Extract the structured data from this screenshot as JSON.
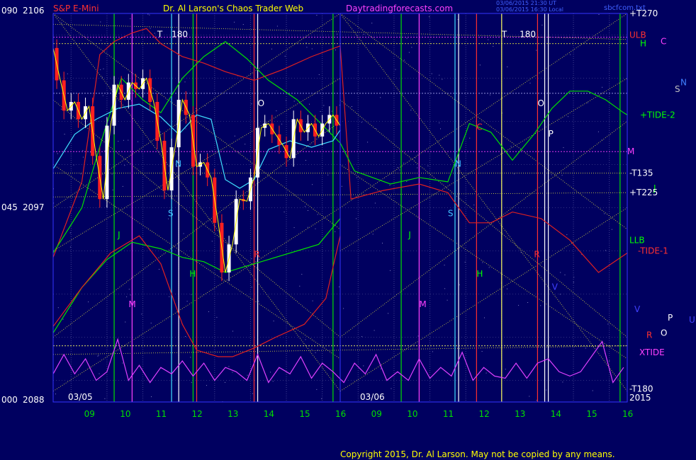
{
  "header": {
    "instrument": "S&P E-Mini",
    "site": "Dr. Al Larson's Chaos Trader Web",
    "url": "Daytradingforecasts.com",
    "stamp1": "03/06/2015 21:30 UT",
    "stamp2": "03/06/2015 16:30 Local",
    "file": "sbcfcom.txt"
  },
  "copyright": "Copyright 2015, Dr. Al Larson. May not be copied by any means.",
  "colors": {
    "background": "#000060",
    "frame": "#3333ff",
    "price": "#ffffff",
    "down_candle": "#ff2020",
    "yellow": "#ffff00",
    "green": "#00e000",
    "magenta": "#ff40ff",
    "cyan": "#40e0ff",
    "red": "#e02020",
    "xtide": "#e040ff"
  },
  "chart_data": {
    "type": "line",
    "title": "S&P E-Mini",
    "y_axis_labels": [
      {
        "index": "090",
        "price": "2106"
      },
      {
        "index": "045",
        "price": "2097"
      },
      {
        "index": "000",
        "price": "2088"
      }
    ],
    "ylim": [
      2088,
      2106
    ],
    "sessions": [
      {
        "date": "03/05",
        "hours": [
          "09",
          "10",
          "11",
          "12",
          "13",
          "14",
          "15",
          "16"
        ]
      },
      {
        "date": "03/06",
        "hours": [
          "09",
          "10",
          "11",
          "12",
          "13",
          "14",
          "15",
          "16"
        ]
      }
    ],
    "right_labels": [
      {
        "text": "+T270",
        "color": "#ffffff",
        "price": 2106
      },
      {
        "text": "ULB",
        "color": "#ff3030",
        "price": 2105
      },
      {
        "text": "H",
        "color": "#00ff00",
        "price": 2104.6
      },
      {
        "text": "C",
        "color": "#ff40ff",
        "price": 2104.7
      },
      {
        "text": "N",
        "color": "#4080ff",
        "price": 2102.8
      },
      {
        "text": "S",
        "color": "#c0c0c0",
        "price": 2102.5
      },
      {
        "text": "+TIDE-2",
        "color": "#00ff00",
        "price": 2101.3
      },
      {
        "text": "M",
        "color": "#ff40ff",
        "price": 2099.6
      },
      {
        "text": "-T135",
        "color": "#ffffff",
        "price": 2098.6
      },
      {
        "text": "J",
        "color": "#00ff00",
        "price": 2097.9
      },
      {
        "text": "+T225",
        "color": "#ffffff",
        "price": 2097.7
      },
      {
        "text": "LLB",
        "color": "#00ff00",
        "price": 2095.5
      },
      {
        "text": "-TIDE-1",
        "color": "#ff3030",
        "price": 2095.0
      },
      {
        "text": "V",
        "color": "#4040ff",
        "price": 2092.3
      },
      {
        "text": "P",
        "color": "#ffffff",
        "price": 2091.9
      },
      {
        "text": "U",
        "color": "#4040ff",
        "price": 2091.8
      },
      {
        "text": "R",
        "color": "#ff3030",
        "price": 2091.1
      },
      {
        "text": "O",
        "color": "#ffffff",
        "price": 2091.2
      },
      {
        "text": "XTIDE",
        "color": "#ff40ff",
        "price": 2090.3
      },
      {
        "text": "-T180",
        "color": "#ffffff",
        "price": 2088.6
      },
      {
        "text": "2015",
        "color": "#ffffff",
        "price": 2088.2
      }
    ],
    "inline_labels": [
      {
        "text": "T",
        "color": "#ffffff",
        "x": 10.9,
        "price": 2104.9
      },
      {
        "text": "180",
        "color": "#ffffff",
        "x": 11.3,
        "price": 2104.9
      },
      {
        "text": "T",
        "color": "#ffffff",
        "x": 20.5,
        "price": 2104.9
      },
      {
        "text": "180",
        "color": "#ffffff",
        "x": 21.0,
        "price": 2104.9
      },
      {
        "text": "O",
        "color": "#ffffff",
        "x": 13.7,
        "price": 2101.7
      },
      {
        "text": "O",
        "color": "#ffffff",
        "x": 21.5,
        "price": 2101.7
      },
      {
        "text": "C",
        "color": "#ff3030",
        "x": 19.8,
        "price": 2100.6
      },
      {
        "text": "P",
        "color": "#ffffff",
        "x": 21.8,
        "price": 2100.3
      },
      {
        "text": "N",
        "color": "#40c0ff",
        "x": 11.4,
        "price": 2098.9
      },
      {
        "text": "N",
        "color": "#40c0ff",
        "x": 19.2,
        "price": 2098.9
      },
      {
        "text": "S",
        "color": "#40c0ff",
        "x": 11.2,
        "price": 2096.6
      },
      {
        "text": "S",
        "color": "#40c0ff",
        "x": 19.0,
        "price": 2096.6
      },
      {
        "text": "J",
        "color": "#00ff00",
        "x": 9.8,
        "price": 2095.6
      },
      {
        "text": "J",
        "color": "#00ff00",
        "x": 17.9,
        "price": 2095.6
      },
      {
        "text": "R",
        "color": "#ff3030",
        "x": 13.6,
        "price": 2094.7
      },
      {
        "text": "R",
        "color": "#ff3030",
        "x": 21.4,
        "price": 2094.7
      },
      {
        "text": "H",
        "color": "#00ff00",
        "x": 11.8,
        "price": 2093.8
      },
      {
        "text": "H",
        "color": "#00ff00",
        "x": 19.8,
        "price": 2093.8
      },
      {
        "text": "V",
        "color": "#4040ff",
        "x": 21.9,
        "price": 2093.2
      },
      {
        "text": "M",
        "color": "#ff40ff",
        "x": 10.1,
        "price": 2092.4
      },
      {
        "text": "M",
        "color": "#ff40ff",
        "x": 18.2,
        "price": 2092.4
      }
    ],
    "series": [
      {
        "name": "price",
        "color": "#ffffff",
        "x": [
          8.0,
          8.2,
          8.4,
          8.6,
          8.8,
          9.0,
          9.2,
          9.4,
          9.6,
          9.8,
          10.0,
          10.2,
          10.4,
          10.6,
          10.8,
          11.0,
          11.2,
          11.4,
          11.6,
          11.8,
          12.0,
          12.2,
          12.4,
          12.6,
          12.8,
          13.0,
          13.2,
          13.4,
          13.6,
          13.8,
          14.0,
          14.2,
          14.4,
          14.6,
          14.8,
          15.0,
          15.2,
          15.4,
          15.6,
          15.8,
          16.0
        ],
        "y": [
          2104.4,
          2102.9,
          2101.5,
          2101.9,
          2101.1,
          2101.7,
          2099.4,
          2097.4,
          2100.8,
          2102.7,
          2102.0,
          2102.8,
          2102.5,
          2103.0,
          2101.9,
          2100.1,
          2097.8,
          2099.8,
          2102.0,
          2101.3,
          2098.9,
          2099.1,
          2098.4,
          2096.3,
          2094.0,
          2095.3,
          2097.4,
          2097.3,
          2098.4,
          2100.7,
          2100.9,
          2100.4,
          2099.9,
          2099.3,
          2101.1,
          2100.5,
          2100.9,
          2100.3,
          2100.9,
          2101.3,
          2100.8
        ]
      },
      {
        "name": "ULB",
        "color": "#e02020",
        "x": [
          8.0,
          8.8,
          9.3,
          9.7,
          10.2,
          10.6,
          11.0,
          11.6,
          12.2,
          12.8,
          13.6,
          14.4,
          15.2,
          16.0,
          16.3,
          17.2,
          18.2,
          19.0,
          19.6,
          20.2,
          20.8,
          21.6,
          22.4,
          23.2,
          24.0
        ],
        "y": [
          2094.7,
          2098.2,
          2104.1,
          2104.7,
          2105.1,
          2105.3,
          2104.6,
          2104.0,
          2103.7,
          2103.3,
          2102.9,
          2103.4,
          2104.0,
          2104.5,
          2097.4,
          2097.8,
          2098.1,
          2097.7,
          2096.3,
          2096.3,
          2096.8,
          2096.5,
          2095.5,
          2094.0,
          2094.9
        ]
      },
      {
        "name": "LLB",
        "color": "#00e000",
        "x": [
          8.0,
          8.8,
          9.4,
          9.9,
          10.5,
          11.0,
          11.6,
          12.2,
          12.8,
          13.4,
          14.0,
          14.8,
          15.4,
          16.0,
          16.4,
          17.4,
          18.2,
          19.0,
          19.6,
          20.2,
          20.8,
          21.4,
          21.9,
          22.4,
          22.9,
          23.4,
          23.9,
          24.0
        ],
        "y": [
          2094.9,
          2097.0,
          2100.4,
          2103.0,
          2102.0,
          2101.4,
          2103.0,
          2104.0,
          2104.7,
          2103.9,
          2102.9,
          2102.0,
          2101.0,
          2100.0,
          2098.7,
          2098.1,
          2098.4,
          2098.2,
          2100.9,
          2100.5,
          2099.2,
          2100.4,
          2101.6,
          2102.4,
          2102.4,
          2102.0,
          2101.4,
          2101.3
        ]
      },
      {
        "name": "LLB-lower",
        "color": "#00e000",
        "x": [
          8.0,
          8.8,
          9.5,
          10.2,
          11.0,
          11.6,
          12.2,
          12.8,
          13.4,
          14.0,
          14.8,
          15.4,
          16.0
        ],
        "y": [
          2091.2,
          2093.3,
          2094.6,
          2095.4,
          2095.1,
          2094.7,
          2094.5,
          2094.0,
          2094.3,
          2094.6,
          2095.0,
          2095.3,
          2096.5
        ]
      },
      {
        "name": "TIDE",
        "color": "#40e0ff",
        "x": [
          8.0,
          8.6,
          9.2,
          9.8,
          10.4,
          11.0,
          11.5,
          12.0,
          12.4,
          12.8,
          13.2,
          13.6,
          14.0,
          14.6,
          15.2,
          15.8,
          16.0
        ],
        "y": [
          2098.8,
          2100.4,
          2101.1,
          2101.6,
          2101.8,
          2101.2,
          2100.4,
          2101.3,
          2101.1,
          2098.3,
          2097.9,
          2098.3,
          2099.7,
          2100.1,
          2099.8,
          2100.1,
          2100.6
        ]
      },
      {
        "name": "red-low",
        "color": "#e02020",
        "x": [
          8.0,
          8.8,
          9.6,
          10.4,
          11.0,
          11.6,
          12.0,
          12.6,
          13.0,
          13.6,
          14.2,
          15.0,
          15.6,
          16.0
        ],
        "y": [
          2091.5,
          2093.3,
          2094.9,
          2095.7,
          2094.4,
          2091.6,
          2090.4,
          2090.1,
          2090.1,
          2090.5,
          2091.0,
          2091.6,
          2092.8,
          2095.7
        ]
      },
      {
        "name": "XTIDE",
        "color": "#e040ff",
        "x": [
          8.0,
          8.3,
          8.6,
          8.9,
          9.2,
          9.5,
          9.8,
          10.1,
          10.4,
          10.7,
          11.0,
          11.3,
          11.6,
          11.9,
          12.2,
          12.5,
          12.8,
          13.1,
          13.4,
          13.7,
          14.0,
          14.3,
          14.6,
          14.9,
          15.2,
          15.5,
          15.8,
          16.1,
          16.4,
          16.7,
          17.0,
          17.3,
          17.6,
          17.9,
          18.2,
          18.5,
          18.8,
          19.1,
          19.4,
          19.7,
          20.0,
          20.3,
          20.6,
          20.9,
          21.2,
          21.5,
          21.8,
          22.1,
          22.4,
          22.7,
          23.0,
          23.3,
          23.6,
          23.9
        ],
        "y": [
          2089.3,
          2090.2,
          2089.3,
          2090.0,
          2089.0,
          2089.4,
          2090.9,
          2089.0,
          2089.7,
          2088.9,
          2089.6,
          2089.3,
          2089.9,
          2089.2,
          2089.8,
          2089.0,
          2089.6,
          2089.4,
          2089.0,
          2090.2,
          2088.9,
          2089.6,
          2089.3,
          2090.1,
          2089.1,
          2089.8,
          2089.4,
          2088.9,
          2089.8,
          2089.3,
          2090.2,
          2089.0,
          2089.4,
          2089.0,
          2090.0,
          2089.1,
          2089.6,
          2089.2,
          2090.3,
          2089.0,
          2089.6,
          2089.2,
          2089.1,
          2089.8,
          2089.1,
          2089.8,
          2090.0,
          2089.4,
          2089.2,
          2089.4,
          2090.1,
          2090.8,
          2088.9,
          2089.6
        ]
      }
    ]
  }
}
